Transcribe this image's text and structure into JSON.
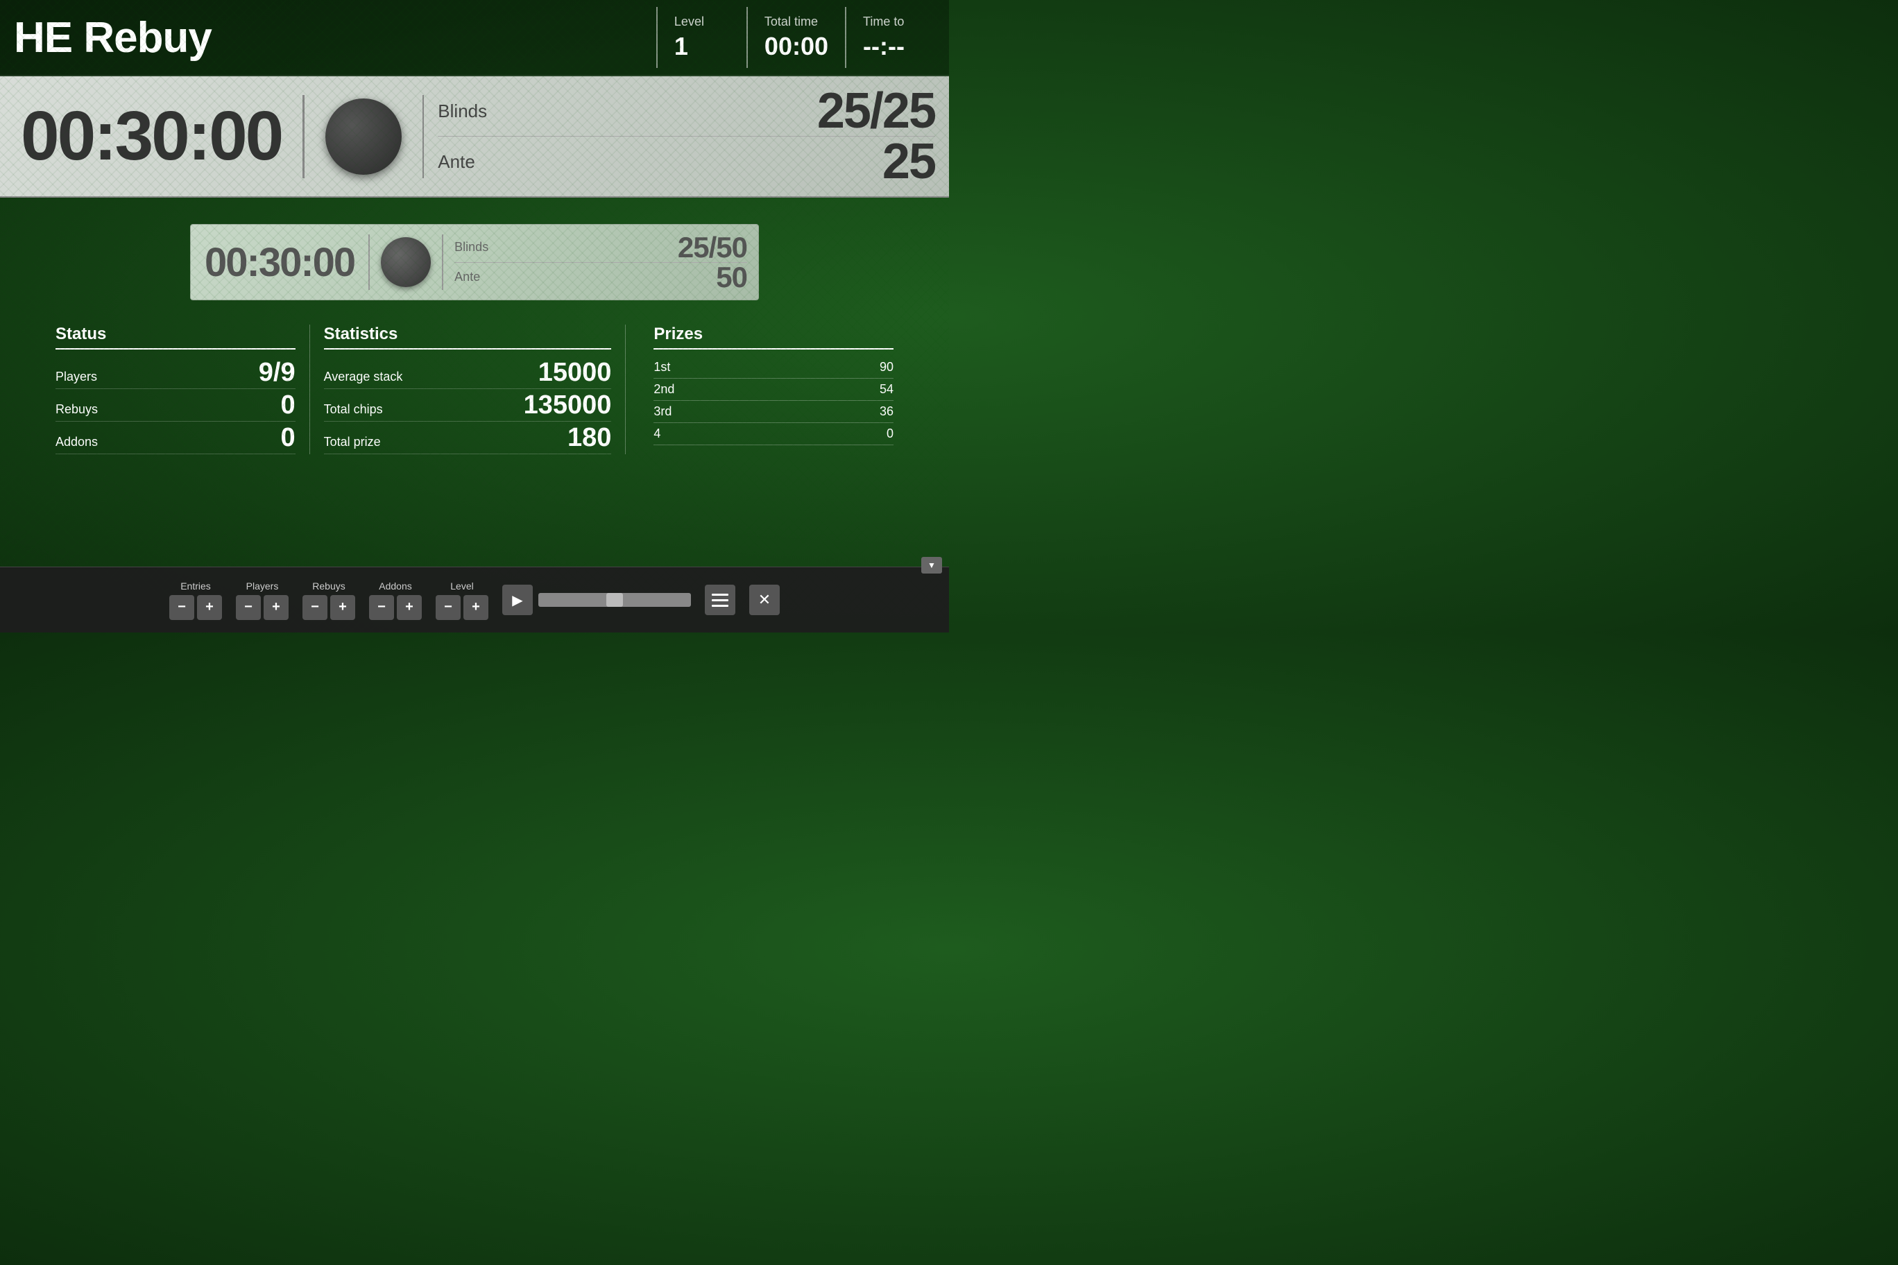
{
  "header": {
    "title": "HE Rebuy",
    "level_label": "Level",
    "level_value": "1",
    "total_time_label": "Total time",
    "total_time_value": "00:00",
    "time_to_label": "Time to",
    "time_to_value": "--:--"
  },
  "main_timer": {
    "time": "00:30:00",
    "blinds_label": "Blinds",
    "blinds_value": "25/25",
    "ante_label": "Ante",
    "ante_value": "25"
  },
  "next_level": {
    "time": "00:30:00",
    "blinds_label": "Blinds",
    "blinds_value": "25/50",
    "ante_label": "Ante",
    "ante_value": "50"
  },
  "status": {
    "header": "Status",
    "players_label": "Players",
    "players_value": "9/9",
    "rebuys_label": "Rebuys",
    "rebuys_value": "0",
    "addons_label": "Addons",
    "addons_value": "0"
  },
  "statistics": {
    "header": "Statistics",
    "avg_stack_label": "Average stack",
    "avg_stack_value": "15000",
    "total_chips_label": "Total chips",
    "total_chips_value": "135000",
    "total_prize_label": "Total prize",
    "total_prize_value": "180"
  },
  "prizes": {
    "header": "Prizes",
    "rows": [
      {
        "place": "1st",
        "amount": "90"
      },
      {
        "place": "2nd",
        "amount": "54"
      },
      {
        "place": "3rd",
        "amount": "36"
      },
      {
        "place": "4",
        "amount": "0"
      }
    ]
  },
  "controls": {
    "entries_label": "Entries",
    "players_label": "Players",
    "rebuys_label": "Rebuys",
    "addons_label": "Addons",
    "level_label": "Level",
    "minus_label": "−",
    "plus_label": "+"
  },
  "icons": {
    "play": "▶",
    "minus": "−",
    "plus": "+",
    "close": "✕",
    "chevron_down": "▼"
  }
}
